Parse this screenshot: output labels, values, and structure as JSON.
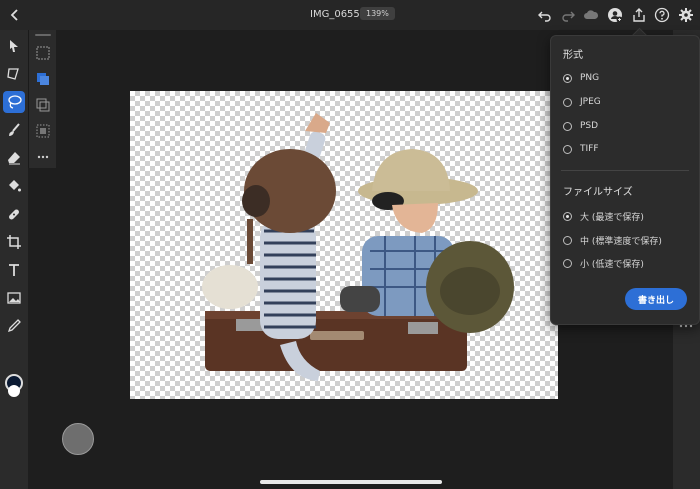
{
  "top_bar": {
    "document_name": "IMG_0655",
    "zoom": "139%",
    "icons": [
      "chevron-left-icon",
      "undo-icon",
      "redo-icon",
      "cloud-icon",
      "account-add-icon",
      "share-export-icon",
      "help-icon",
      "gear-icon"
    ]
  },
  "tools": [
    "select-icon",
    "transform-icon",
    "lasso-icon",
    "brush-icon",
    "eraser-icon",
    "fill-icon",
    "healing-icon",
    "crop-icon",
    "text-icon",
    "image-icon",
    "eyedropper-icon"
  ],
  "colors": {
    "accent": "#2d6fd6",
    "foreground_color": "#0b1a33",
    "background_color": "#ffffff"
  },
  "export_panel": {
    "format_heading": "形式",
    "formats": [
      {
        "label": "PNG",
        "selected": true
      },
      {
        "label": "JPEG",
        "selected": false
      },
      {
        "label": "PSD",
        "selected": false
      },
      {
        "label": "TIFF",
        "selected": false
      }
    ],
    "size_heading": "ファイルサイズ",
    "sizes": [
      {
        "label": "大 (最速で保存)",
        "selected": true
      },
      {
        "label": "中 (標準速度で保存)",
        "selected": false
      },
      {
        "label": "小 (低速で保存)",
        "selected": false
      }
    ],
    "export_button": "書き出し"
  }
}
